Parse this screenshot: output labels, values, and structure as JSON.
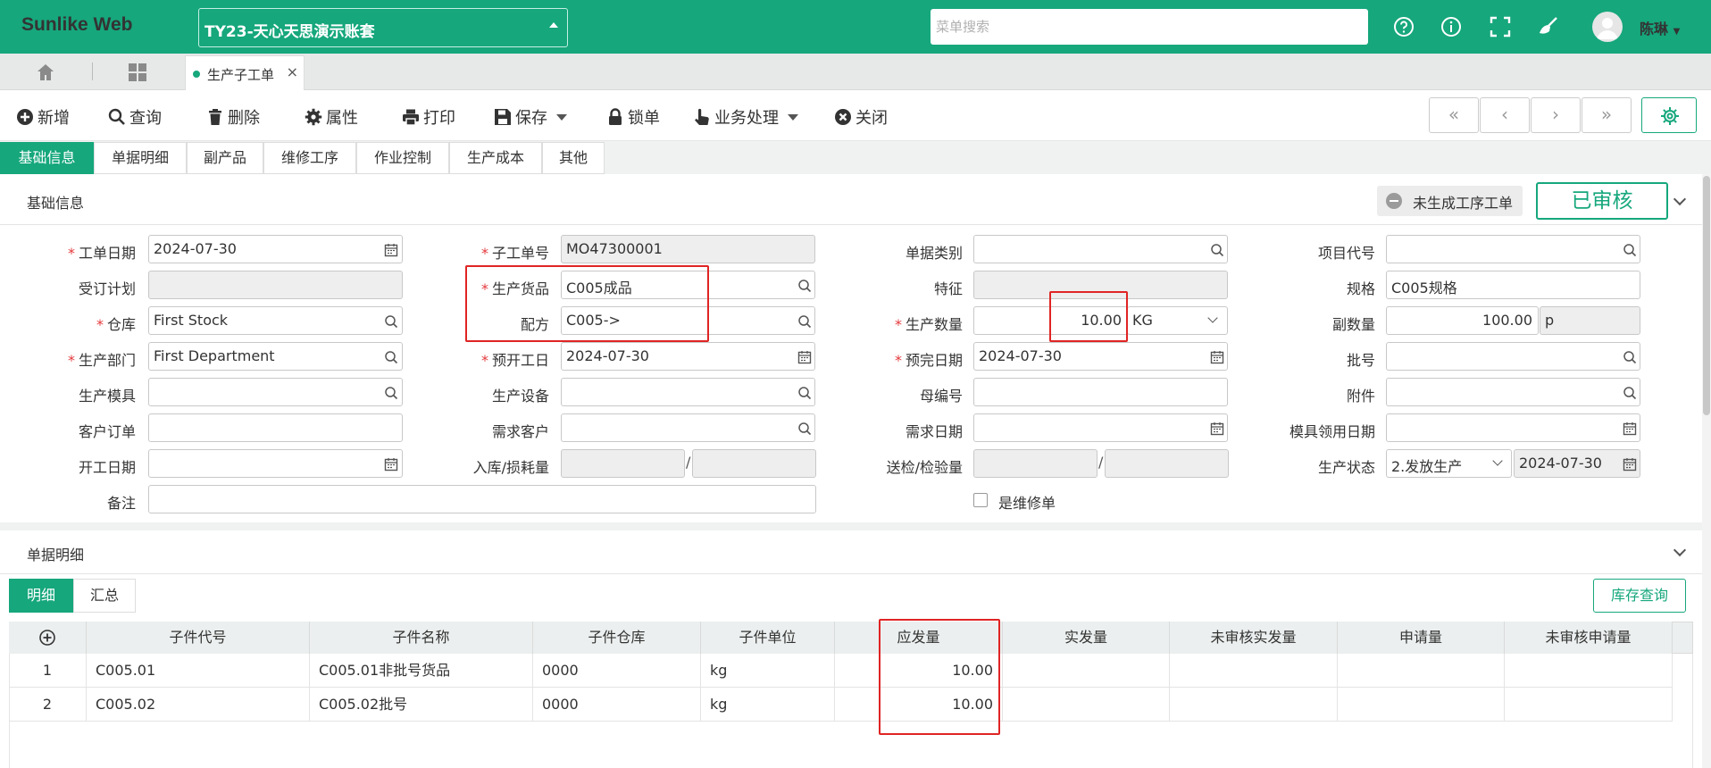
{
  "app": {
    "brand": "Sunlike Web",
    "account": "TY23-天心天思演示账套",
    "search_placeholder": "菜单搜索",
    "user": "陈琳"
  },
  "tabs": {
    "document_tab": "生产子工单"
  },
  "toolbar": {
    "new": "新增",
    "query": "查询",
    "delete": "删除",
    "properties": "属性",
    "print": "打印",
    "save": "保存",
    "lock": "锁单",
    "business": "业务处理",
    "close": "关闭"
  },
  "form_tabs": [
    "基础信息",
    "单据明细",
    "副产品",
    "维修工序",
    "作业控制",
    "生产成本",
    "其他"
  ],
  "basic": {
    "section_title": "基础信息",
    "status_text": "未生成工序工单",
    "approved_label": "已审核",
    "fields": {
      "work_date": {
        "label": "工单日期",
        "value": "2024-07-30"
      },
      "order_plan": {
        "label": "受订计划",
        "value": ""
      },
      "warehouse": {
        "label": "仓库",
        "value": "First Stock"
      },
      "dept": {
        "label": "生产部门",
        "value": "First Department"
      },
      "mold": {
        "label": "生产模具",
        "value": ""
      },
      "customer_order": {
        "label": "客户订单",
        "value": ""
      },
      "start_date": {
        "label": "开工日期",
        "value": ""
      },
      "remark": {
        "label": "备注",
        "value": ""
      },
      "sub_order_no": {
        "label": "子工单号",
        "value": "MO47300001"
      },
      "product": {
        "label": "生产货品",
        "value": "C005成品"
      },
      "formula": {
        "label": "配方",
        "value": "C005->"
      },
      "plan_start": {
        "label": "预开工日",
        "value": "2024-07-30"
      },
      "equipment": {
        "label": "生产设备",
        "value": ""
      },
      "demand_customer": {
        "label": "需求客户",
        "value": ""
      },
      "in_loss": {
        "label": "入库/损耗量",
        "value1": "",
        "value2": ""
      },
      "doc_type": {
        "label": "单据类别",
        "value": ""
      },
      "feature": {
        "label": "特征",
        "value": ""
      },
      "qty": {
        "label": "生产数量",
        "value": "10.00",
        "unit": "KG"
      },
      "plan_finish": {
        "label": "预完日期",
        "value": "2024-07-30"
      },
      "parent_no": {
        "label": "母编号",
        "value": ""
      },
      "demand_date": {
        "label": "需求日期",
        "value": ""
      },
      "inspect": {
        "label": "送检/检验量",
        "value1": "",
        "value2": ""
      },
      "repair": {
        "label": "是维修单",
        "checked": false
      },
      "project": {
        "label": "项目代号",
        "value": ""
      },
      "spec": {
        "label": "规格",
        "value": "C005规格"
      },
      "sub_qty": {
        "label": "副数量",
        "value": "100.00",
        "unit": "p"
      },
      "batch": {
        "label": "批号",
        "value": ""
      },
      "attachment": {
        "label": "附件",
        "value": ""
      },
      "mold_date": {
        "label": "模具领用日期",
        "value": ""
      },
      "prod_status": {
        "label": "生产状态",
        "value": "2.发放生产",
        "date": "2024-07-30"
      }
    }
  },
  "detail": {
    "section_title": "单据明细",
    "subtabs": [
      "明细",
      "汇总"
    ],
    "stock_query": "库存查询",
    "columns": [
      "子件代号",
      "子件名称",
      "子件仓库",
      "子件单位",
      "应发量",
      "实发量",
      "未审核实发量",
      "申请量",
      "未审核申请量"
    ],
    "rows": [
      {
        "no": "1",
        "code": "C005.01",
        "name": "C005.01非批号货品",
        "wh": "0000",
        "unit": "kg",
        "due": "10.00",
        "actual": "",
        "unapproved_actual": "",
        "apply": "",
        "unapproved_apply": ""
      },
      {
        "no": "2",
        "code": "C005.02",
        "name": "C005.02批号",
        "wh": "0000",
        "unit": "kg",
        "due": "10.00",
        "actual": "",
        "unapproved_actual": "",
        "apply": "",
        "unapproved_apply": ""
      }
    ]
  }
}
